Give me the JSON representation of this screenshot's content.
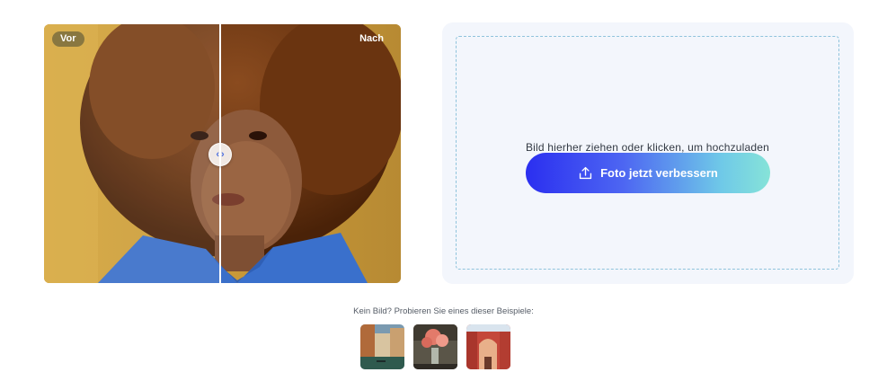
{
  "compare": {
    "before_label": "Vor",
    "after_label": "Nach",
    "handle_left": "‹",
    "handle_right": "›"
  },
  "upload": {
    "hint": "Bild hierher ziehen oder klicken, um hochzuladen",
    "button_label": "Foto jetzt verbessern",
    "button_icon": "upload-icon"
  },
  "examples": {
    "label": "Kein Bild? Probieren Sie eines dieser Beispiele:",
    "items": [
      {
        "name": "venice-canal"
      },
      {
        "name": "roses-vase"
      },
      {
        "name": "red-street"
      }
    ]
  },
  "colors": {
    "button_gradient_start": "#2b2ff0",
    "button_gradient_end": "#86e3d8",
    "panel_bg": "#f3f6fc",
    "dropzone_border": "#8fc3dc"
  }
}
